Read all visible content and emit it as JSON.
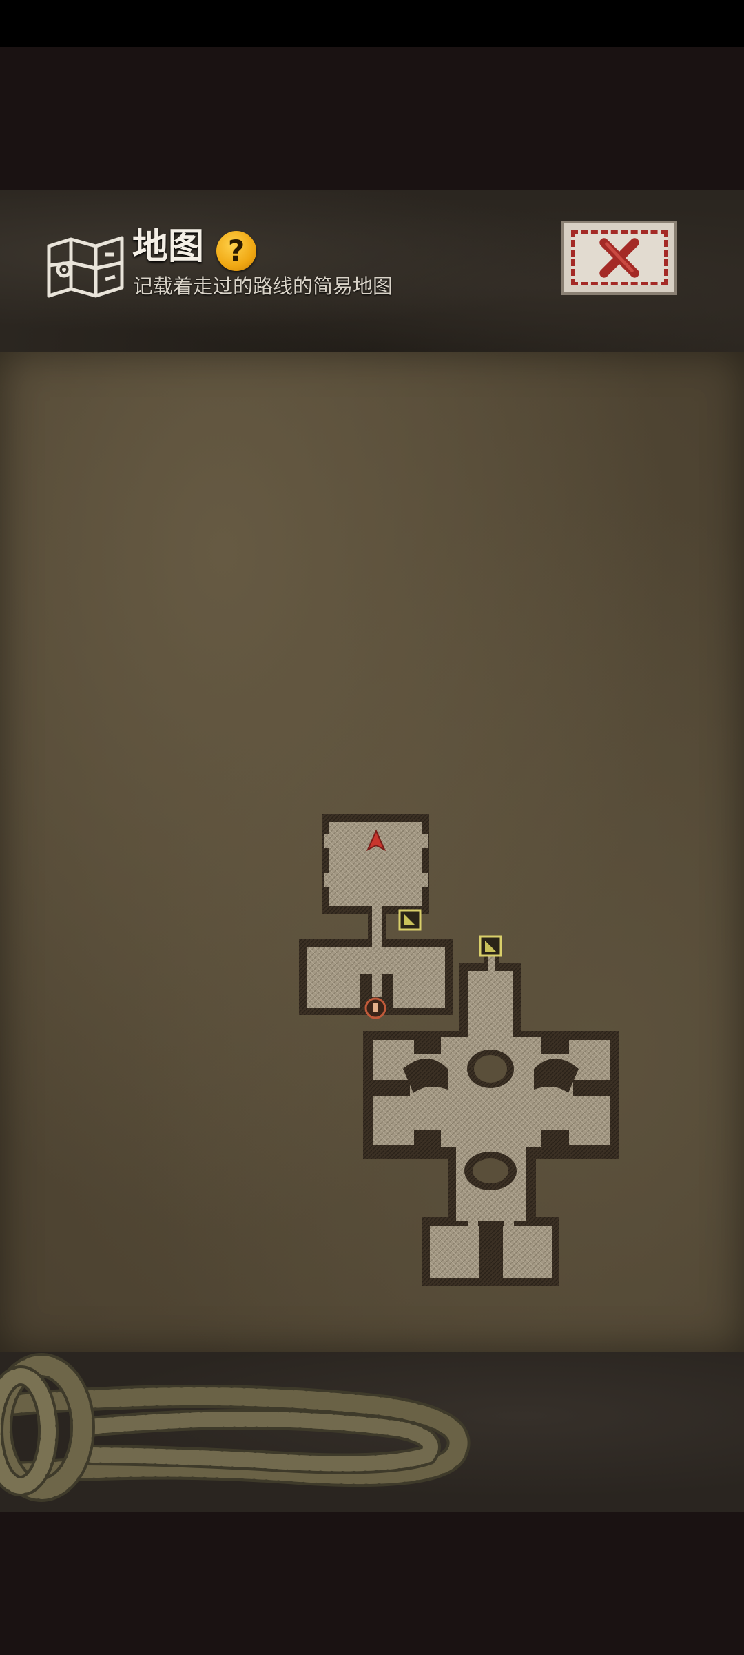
{
  "header": {
    "title": "地图",
    "help_glyph": "?",
    "subtitle": "记载着走过的路线的简易地图",
    "icon": "folded-map-icon"
  },
  "close": {
    "icon": "close-x-icon",
    "color": "#a42a26"
  },
  "map": {
    "player_marker_color": "#c8352d",
    "floor_color": "#a49a86",
    "wall_color": "#3a2e22",
    "icons": [
      "player-arrow-icon",
      "stairs-icon",
      "stairs-icon",
      "door-marker-icon"
    ]
  },
  "footer": {
    "decoration": "coiled-rope"
  }
}
